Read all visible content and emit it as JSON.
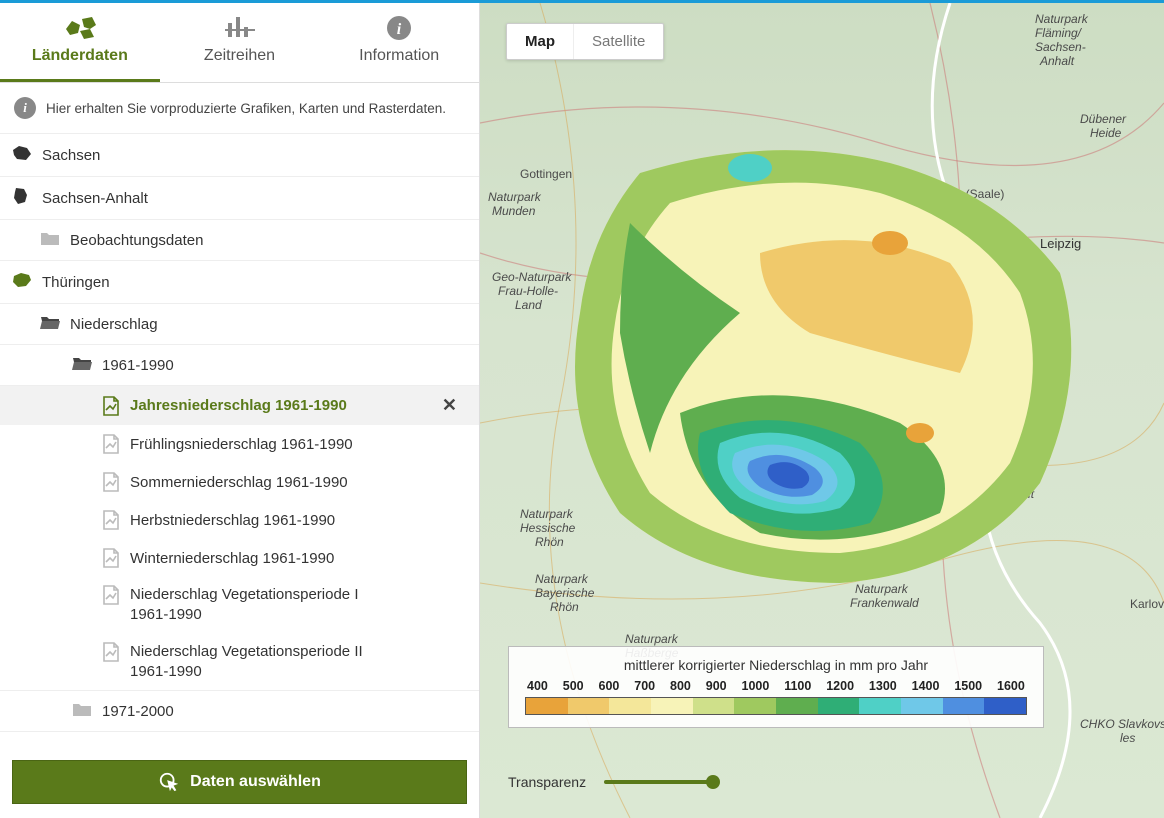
{
  "tabs": [
    {
      "label": "Länderdaten",
      "icon": "region-cluster-icon",
      "active": true
    },
    {
      "label": "Zeitreihen",
      "icon": "bars-icon",
      "active": false
    },
    {
      "label": "Information",
      "icon": "info-icon",
      "active": false
    }
  ],
  "hint": "Hier erhalten Sie vorproduzierte Grafiken, Karten und Rasterdaten.",
  "tree": {
    "regions": [
      {
        "name": "Sachsen",
        "icon": "region-sachsen-icon"
      },
      {
        "name": "Sachsen-Anhalt",
        "icon": "region-sachsen-anhalt-icon",
        "folders": [
          {
            "name": "Beobachtungsdaten",
            "open": false
          }
        ]
      },
      {
        "name": "Thüringen",
        "icon": "region-thueringen-icon",
        "selected_region": true,
        "folders": [
          {
            "name": "Niederschlag",
            "open": true,
            "subfolders": [
              {
                "name": "1961-1990",
                "open": true,
                "items": [
                  {
                    "label": "Jahresniederschlag 1961-1990",
                    "selected": true
                  },
                  {
                    "label": "Frühlingsniederschlag 1961-1990"
                  },
                  {
                    "label": "Sommerniederschlag 1961-1990"
                  },
                  {
                    "label": "Herbstniederschlag 1961-1990"
                  },
                  {
                    "label": "Winterniederschlag 1961-1990"
                  },
                  {
                    "label": "Niederschlag Vegetationsperiode I 1961-1990",
                    "multiline": true
                  },
                  {
                    "label": "Niederschlag Vegetationsperiode II 1961-1990",
                    "multiline": true
                  }
                ]
              },
              {
                "name": "1971-2000",
                "open": false
              }
            ]
          }
        ]
      }
    ]
  },
  "select_button": "Daten auswählen",
  "maptype": {
    "map": "Map",
    "satellite": "Satellite"
  },
  "legend": {
    "title": "mittlerer korrigierter Niederschlag in mm pro Jahr",
    "ticks": [
      "400",
      "500",
      "600",
      "700",
      "800",
      "900",
      "1000",
      "1100",
      "1200",
      "1300",
      "1400",
      "1500",
      "1600"
    ],
    "colors": [
      "#e8a33a",
      "#f0c96b",
      "#f4e79a",
      "#f7f3b8",
      "#cfe08a",
      "#9fc95f",
      "#5fae4f",
      "#2fae76",
      "#4fd0c6",
      "#6fc8e8",
      "#4f8fe0",
      "#2f5fc8"
    ]
  },
  "transparency_label": "Transparenz",
  "map_labels": {
    "gottingen": "Gottingen",
    "halle": "Halle (Saale)",
    "leipzig": "Leipzig",
    "sachsen_anhalt": "Sachsen-\nAnhalt",
    "dubener": "Dübener\nHeide",
    "flaming": "Naturpark\nFläming/\nSachsen-\nAnhalt",
    "munden": "Naturpark\nMunden",
    "frauholle": "Geo-Naturpark\nFrau-Holle-\nLand",
    "rhon": "Naturpark\nHessische\nRhön",
    "bayrhon": "Naturpark\nBayerische\nRhön",
    "hassberge": "Naturpark\nHaßberge",
    "frankenwald": "Naturpark\nFrankenwald",
    "slavkov": "CHKO Slavkovs\nles",
    "karlov": "Karlov"
  }
}
